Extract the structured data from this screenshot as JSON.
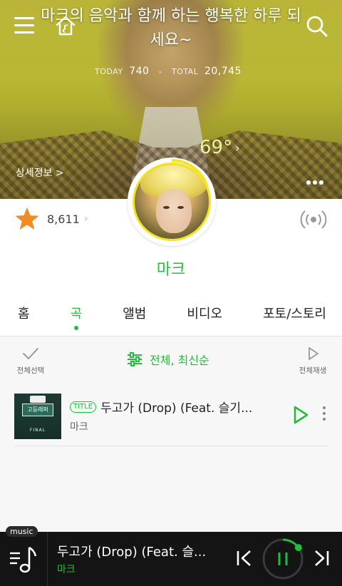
{
  "header": {
    "title": "마크의 음악과 함께 하는 행복한 하루 되세요~",
    "today_label": "TODAY",
    "today_count": "740",
    "total_label": "TOTAL",
    "total_count": "20,745",
    "temperature": "69°",
    "detail_link": "상세정보 >"
  },
  "profile": {
    "artist_name": "마크",
    "likes": "8,611"
  },
  "tabs": [
    {
      "label": "홈",
      "active": false
    },
    {
      "label": "곡",
      "active": true
    },
    {
      "label": "앨범",
      "active": false
    },
    {
      "label": "비디오",
      "active": false
    },
    {
      "label": "포토/스토리",
      "active": false
    }
  ],
  "toolbar": {
    "select_all": "전체선택",
    "filter": "전체, 최신순",
    "play_all": "전체재생"
  },
  "songs": [
    {
      "tag": "TITLE",
      "title": "두고가 (Drop) (Feat. 슬기...",
      "artist": "마크",
      "album_badge": "고등래퍼",
      "album_sub": "FINAL"
    }
  ],
  "player": {
    "chip": "music",
    "now_title": "두고가 (Drop) (Feat. 슬...",
    "now_artist": "마크",
    "progress": 0.15
  },
  "colors": {
    "accent": "#1fbf3a",
    "star": "#f28b22",
    "player_bg": "#141414"
  },
  "icons": [
    "menu-icon",
    "home-icon",
    "search-icon",
    "star-icon",
    "radio-wave-icon",
    "check-icon",
    "filter-icon",
    "play-icon",
    "more-icon",
    "music-note-icon",
    "previous-icon",
    "pause-icon",
    "next-icon"
  ]
}
